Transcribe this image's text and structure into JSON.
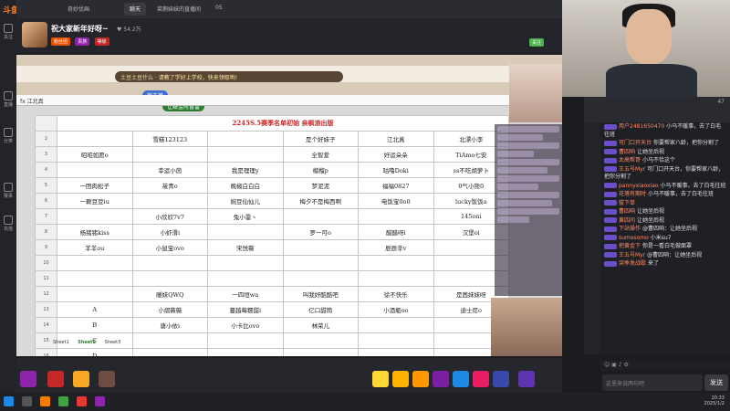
{
  "app": {
    "logo": "斗鱼"
  },
  "nav": [
    "关注",
    "直播",
    "分类",
    "赛事",
    "充值"
  ],
  "tabs": [
    "奇妙优画",
    "聊天",
    "菜鹅妹妹的直播间",
    "05"
  ],
  "stream": {
    "title": "祝大家新年好呀~",
    "stats": "♥ 54.2万",
    "badges": [
      "粉丝团",
      "贵族",
      "等级"
    ],
    "follow": "关注"
  },
  "sheet": {
    "banner": "土豆土豆什么 · 请教了学好上学校，快来领取哟!",
    "gift1": "我下单",
    "gift2": "让缺金时盲雷",
    "formula": "fx  江北真",
    "title": "2245S.5赛季名单初始 亲枫浪出版",
    "rows": [
      [
        "",
        "雪糕123123",
        "",
        "是个好妹子",
        "江北真",
        "北漂小李"
      ],
      [
        "昭昭如愿o",
        "",
        "",
        "全智爱",
        "好运朵朵",
        "TiAmo七安"
      ],
      [
        "",
        "幸运小茵",
        "我是理理y",
        "榴榴p",
        "咕噜Doki",
        "ss不吃胡萝卜"
      ],
      [
        "一团肉松子",
        "莜青o",
        "晚椒白白白",
        "梦泥泥",
        "福福0827",
        "0气小熊0"
      ],
      [
        "一颗豆豆iu",
        "",
        "婉豆仙仙儿",
        "梅夕不是梅西啊",
        "电饭宝0o0",
        "lucky饭饭a"
      ],
      [
        "",
        "小欣欣7v7",
        "兔小雷丶",
        "",
        "",
        "145oni"
      ],
      [
        "杨猪猪kiss",
        "小虾滑i",
        "",
        "罗一可o",
        "醋醋呀i",
        "汉堡oi"
      ],
      [
        "羊羊ou",
        "小鼠宝ovo",
        "宋悦薇",
        "",
        "辰辰辛v",
        ""
      ],
      [
        "",
        "",
        "",
        "",
        "",
        ""
      ],
      [
        "",
        "",
        "",
        "",
        "",
        ""
      ],
      [
        "",
        "暖妹QWQ",
        "一四垣wa",
        "叫我好酷酷吧",
        "徐不快乐",
        "是茜妹妹呀"
      ],
      [
        "A",
        "小熠薇薇",
        "蔓越莓糯甜i",
        "亿口甜筒",
        "小酒瓶oo",
        "迪士尼o"
      ],
      [
        "B",
        "唐小依i",
        "小卡比ovo",
        "林荣儿",
        "",
        ""
      ],
      [
        "C",
        "",
        "",
        "",
        "",
        ""
      ],
      [
        "D",
        "",
        "",
        "",
        "",
        ""
      ]
    ],
    "sheet_tabs": [
      "Sheet1",
      "Sheet2",
      "Sheet3"
    ]
  },
  "chat": {
    "rank": "47",
    "messages": [
      {
        "name": "用户2481650470",
        "text": "小马不暖事，去了白毛往班"
      },
      {
        "name": "可门口开天台",
        "text": "你要帮家八龄，把你分割了"
      },
      {
        "name": "曹四响",
        "text": "让她坐后视"
      },
      {
        "name": "太高帮哥",
        "text": "小马不恰这个"
      },
      {
        "name": "王五号Myr",
        "text": "可门口开天台，你要帮家八龄，把你分割了"
      },
      {
        "name": "pannyxiaoxiao",
        "text": "小马不暖事，去了白毛往班"
      },
      {
        "name": "花落有期时",
        "text": "小马不暖事，去了白毛往班"
      },
      {
        "name": "拔下单",
        "text": ""
      },
      {
        "name": "曹四响",
        "text": "让她坐后视"
      },
      {
        "name": "黄四问",
        "text": "让她坐后视"
      },
      {
        "name": "下站操作",
        "text": "@曹四响：让她坐后视"
      },
      {
        "name": "sumosomo",
        "text": "小米su7"
      },
      {
        "name": "把黄金下",
        "text": "你是一看白毛做面罩"
      },
      {
        "name": "王五号Myr",
        "text": "@曹四响：让她坐后视"
      },
      {
        "name": "突季发战歌",
        "text": "来了"
      }
    ],
    "input_placeholder": "这里来说两句吧",
    "send": "发送"
  },
  "clock": {
    "time": "20:33",
    "date": "2025/1/2"
  }
}
